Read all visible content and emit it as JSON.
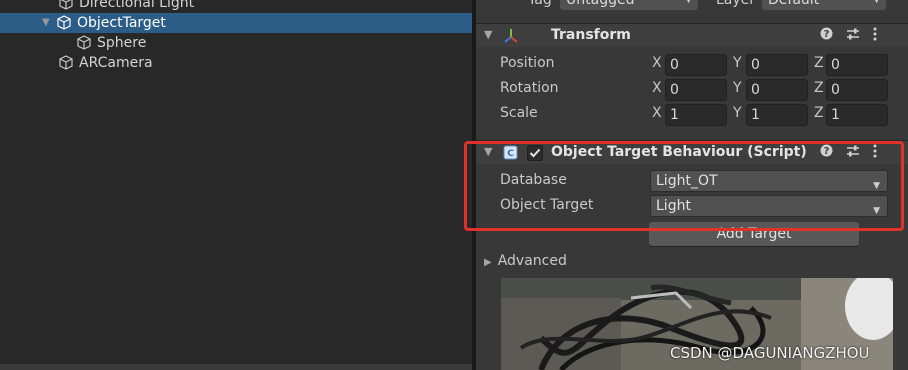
{
  "hierarchy": {
    "items": [
      {
        "label": "Directional Light"
      },
      {
        "label": "ObjectTarget"
      },
      {
        "label": "Sphere"
      },
      {
        "label": "ARCamera"
      }
    ]
  },
  "inspector": {
    "tag_label": "Tag",
    "tag_value": "Untagged",
    "layer_label": "Layer",
    "layer_value": "Default",
    "transform": {
      "title": "Transform",
      "position_label": "Position",
      "rotation_label": "Rotation",
      "scale_label": "Scale",
      "axis_x": "X",
      "axis_y": "Y",
      "axis_z": "Z",
      "position": {
        "x": "0",
        "y": "0",
        "z": "0"
      },
      "rotation": {
        "x": "0",
        "y": "0",
        "z": "0"
      },
      "scale": {
        "x": "1",
        "y": "1",
        "z": "1"
      }
    },
    "behaviour": {
      "title": "Object Target Behaviour (Script)",
      "database_label": "Database",
      "database_value": "Light_OT",
      "object_target_label": "Object Target",
      "object_target_value": "Light",
      "add_target_label": "Add Target",
      "advanced_label": "Advanced"
    }
  },
  "watermark": "CSDN @DAGUNIANGZHOU",
  "colors": {
    "selection": "#2c5d87",
    "highlight_box": "#e2312b",
    "panel_bg": "#383838"
  }
}
